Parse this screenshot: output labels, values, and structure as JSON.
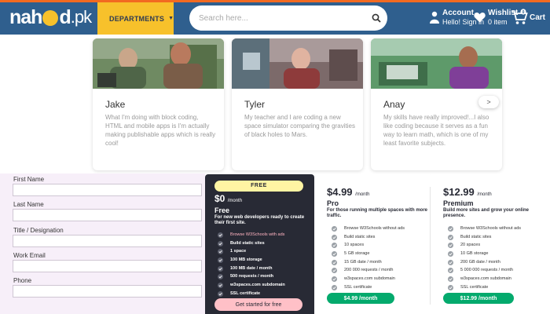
{
  "header": {
    "logo_left": "nah",
    "logo_right": "d",
    "logo_domain": ".pk",
    "departments_label": "DEPARTMENTS",
    "search_placeholder": "Search here...",
    "account_title": "Account",
    "account_sub": "Hello! Sign in",
    "wishlist_title": "Wishlist",
    "wishlist_sub": "0 item",
    "cart_label": "Cart"
  },
  "testimonials": [
    {
      "name": "Jake",
      "quote": "What I'm doing with block coding, HTML and mobile apps is I'm actually making publishable apps which is really cool!"
    },
    {
      "name": "Tyler",
      "quote": "My teacher and I are coding a new space simulator comparing the gravities of black holes to Mars."
    },
    {
      "name": "Anay",
      "quote": "My skills have really improved!...I also like coding because it serves as a fun way to learn math, which is one of my least favorite subjects."
    }
  ],
  "testimonial_next": ">",
  "form": {
    "fields": [
      {
        "label": "First Name"
      },
      {
        "label": "Last Name"
      },
      {
        "label": "Title / Designation"
      },
      {
        "label": "Work Email"
      },
      {
        "label": "Phone"
      }
    ]
  },
  "plans": {
    "free": {
      "badge": "FREE",
      "price": "$0",
      "per": "/month",
      "name": "Free",
      "desc": "For new web developers ready to create their first site.",
      "features": [
        "Browse W3Schools with ads",
        "Build static sites",
        "1 space",
        "100 MB storage",
        "100 MB date / month",
        "500 requests / month",
        "w3spaces.com subdomain",
        "SSL certificate"
      ],
      "cta": "Get started for free"
    },
    "pro": {
      "price": "$4.99",
      "per": "/month",
      "name": "Pro",
      "desc": "For those running multiple spaces with more traffic.",
      "features": [
        "Browse W3Schools without ads",
        "Build static sites",
        "10 spaces",
        "5 GB storage",
        "15 GB date / month",
        "200 000 requests / month",
        "w3spaces.com subdomain",
        "SSL certificate"
      ],
      "cta": "$4.99 /month"
    },
    "premium": {
      "price": "$12.99",
      "per": "/month",
      "name": "Premium",
      "desc": "Build more sites and grow your online presence.",
      "features": [
        "Browse W3Schools without ads",
        "Build static sites",
        "20 spaces",
        "10 GB storage",
        "200 GB date / month",
        "5 000 000 requests / month",
        "w3spaces.com subdomain",
        "SSL certificate"
      ],
      "cta": "$12.99 /month"
    }
  },
  "colors": {
    "header_bg": "#2f5f8e",
    "accent_yellow": "#f7c12b",
    "free_bg": "#282a35",
    "free_badge": "#fff4a3",
    "free_cta": "#ffc0c7",
    "highlight_pink": "#ffb3c1",
    "green": "#04aa6d"
  }
}
